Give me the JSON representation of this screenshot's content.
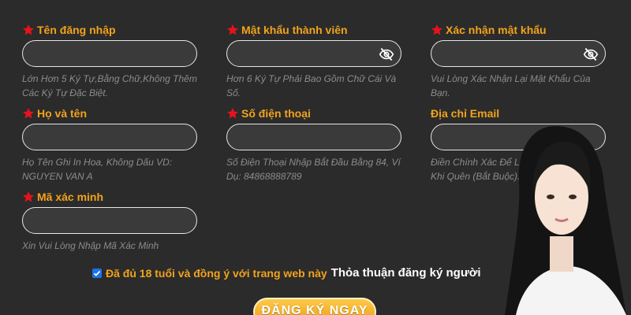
{
  "fields": [
    {
      "label": "Tên đăng nhập",
      "hint": "Lớn Hơn 5 Ký Tự,Bằng Chữ,Không Thêm Các Ký Tự Đặc Biệt.",
      "value": "",
      "placeholder": ""
    },
    {
      "label": "Mật khẩu thành viên",
      "hint": "Hơn 6 Ký Tự Phải Bao Gồm Chữ Cái Và Số.",
      "value": "",
      "placeholder": "",
      "icon": "eye-slash-icon"
    },
    {
      "label": "Xác nhận mật khẩu",
      "hint": "Vui Lòng Xác Nhận Lại Mật Khẩu Của Bạn.",
      "value": "",
      "placeholder": "",
      "icon": "eye-slash-icon"
    },
    {
      "label": "Họ và tên",
      "hint": "Họ Tên Ghi In Hoa, Không Dấu VD: NGUYEN VAN A",
      "value": "",
      "placeholder": ""
    },
    {
      "label": "Số điện thoại",
      "hint": "Số Điện Thoại Nhập Bắt Đầu Bằng 84, Ví Dụ: 84868888789",
      "value": "",
      "placeholder": ""
    },
    {
      "label": "Địa chỉ Email",
      "hint": "Điền Chính Xác Để Lấ Khi Quên (Bắt Buộc).",
      "value": "",
      "placeholder": ""
    },
    {
      "label": "Mã xác minh",
      "hint": "Xin Vui Lòng Nhập Mã Xác Minh",
      "value": "",
      "placeholder": ""
    }
  ],
  "agreement": {
    "checked": true,
    "text": "Đã đủ 18 tuổi và đồng ý với trang web này",
    "link": "Thỏa thuận đăng ký người"
  },
  "register_button": "ĐĂNG KÝ NGAY",
  "colors": {
    "background": "#2b2b2b",
    "label": "#f2a31b",
    "star": "#e8121c",
    "hint": "#8c8c8c",
    "button": "#f5b025"
  }
}
